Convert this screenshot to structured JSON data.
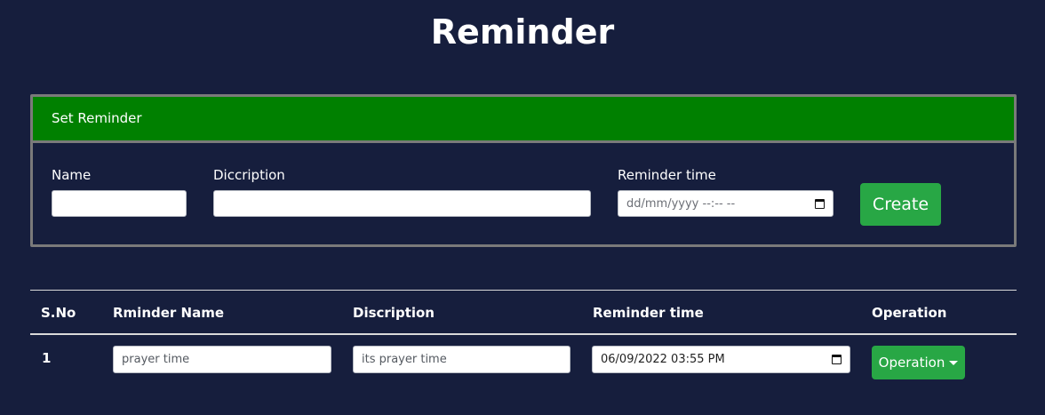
{
  "page": {
    "title": "Reminder"
  },
  "form": {
    "header": "Set Reminder",
    "name_label": "Name",
    "description_label": "Diccription",
    "time_label": "Reminder time",
    "time_placeholder": "dd/mm/yyyy --:-- --",
    "create_label": "Create"
  },
  "table": {
    "columns": [
      "S.No",
      "Rminder Name",
      "Discription",
      "Reminder time",
      "Operation"
    ],
    "rows": [
      {
        "sno": "1",
        "name": "prayer time",
        "description": "its prayer time",
        "time": "06/09/2022 03:55 PM",
        "operation_label": "Operation"
      }
    ]
  },
  "colors": {
    "background": "#161e3d",
    "header_green": "#008000",
    "button_green": "#28a745",
    "border_gray": "#7a7a7a"
  },
  "icons": {
    "calendar": "calendar-icon",
    "dropdown": "caret-down-icon"
  }
}
